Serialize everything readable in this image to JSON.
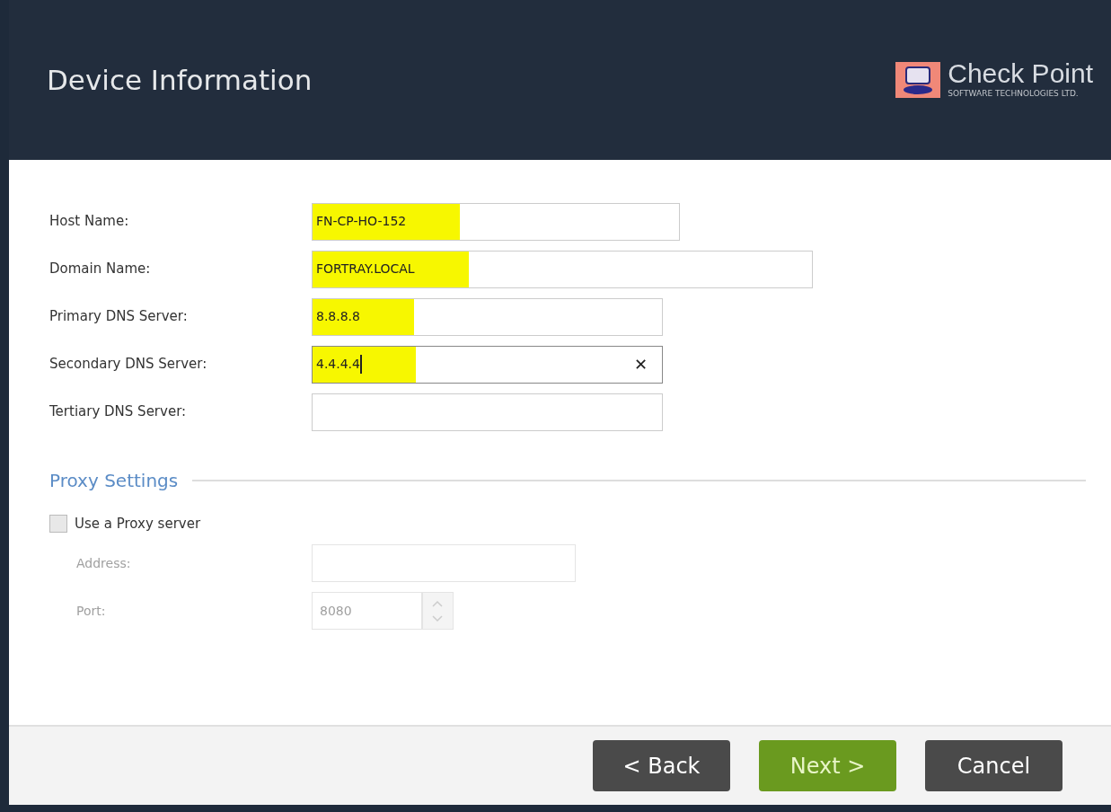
{
  "header": {
    "title": "Device Information",
    "logo": {
      "name": "Check Point",
      "tagline": "SOFTWARE TECHNOLOGIES LTD."
    }
  },
  "fields": [
    {
      "label": "Host Name:",
      "value": "FN-CP-HO-152",
      "highlighted": true,
      "focused": false
    },
    {
      "label": "Domain Name:",
      "value": "FORTRAY.LOCAL",
      "highlighted": true,
      "focused": false
    },
    {
      "label": "Primary DNS Server:",
      "value": "8.8.8.8",
      "highlighted": true,
      "focused": false
    },
    {
      "label": "Secondary DNS Server:",
      "value": "4.4.4.4",
      "highlighted": true,
      "focused": true,
      "clear": "✕"
    },
    {
      "label": "Tertiary DNS Server:",
      "focused": false
    }
  ],
  "proxy": {
    "heading": "Proxy Settings",
    "checkbox": {
      "label": "Use a Proxy server",
      "checked": false
    },
    "address": {
      "label": "Address:",
      "disabled": true
    },
    "port": {
      "label": "Port:",
      "value": "8080",
      "disabled": true
    }
  },
  "buttons": [
    {
      "label": "< Back",
      "kind": "secondary"
    },
    {
      "label": "Next >",
      "kind": "primary"
    },
    {
      "label": "Cancel",
      "kind": "secondary"
    }
  ]
}
